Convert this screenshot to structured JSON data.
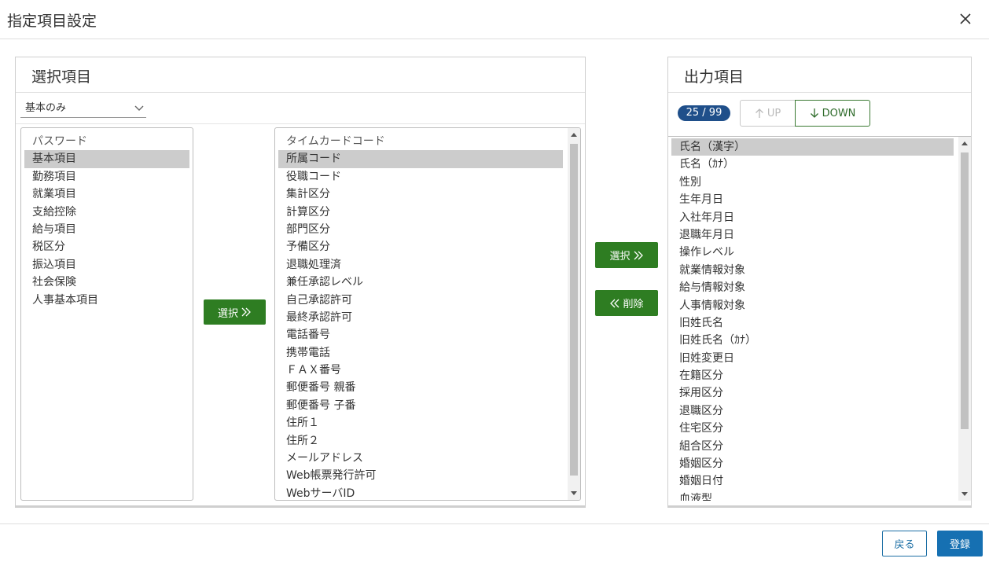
{
  "dialog": {
    "title": "指定項目設定"
  },
  "left_panel": {
    "title": "選択項目",
    "dropdown_value": "基本のみ",
    "categories": [
      "パスワード",
      "基本項目",
      "勤務項目",
      "就業項目",
      "支給控除",
      "給与項目",
      "税区分",
      "振込項目",
      "社会保険",
      "人事基本項目"
    ],
    "selected_category_index": 1,
    "items": [
      "タイムカードコード",
      "所属コード",
      "役職コード",
      "集計区分",
      "計算区分",
      "部門区分",
      "予備区分",
      "退職処理済",
      "兼任承認レベル",
      "自己承認許可",
      "最終承認許可",
      "電話番号",
      "携帯電話",
      "ＦＡＸ番号",
      "郵便番号 親番",
      "郵便番号 子番",
      "住所１",
      "住所２",
      "メールアドレス",
      "Web帳票発行許可",
      "WebサーバID"
    ],
    "selected_item_index": 1,
    "select_label": "選択"
  },
  "middle": {
    "select_label": "選択",
    "remove_label": "削除"
  },
  "right_panel": {
    "title": "出力項目",
    "count": "25 / 99",
    "up_label": "UP",
    "down_label": "DOWN",
    "items": [
      "氏名（漢字）",
      "氏名（ｶﾅ）",
      "性別",
      "生年月日",
      "入社年月日",
      "退職年月日",
      "操作レベル",
      "就業情報対象",
      "給与情報対象",
      "人事情報対象",
      "旧姓氏名",
      "旧姓氏名（ｶﾅ）",
      "旧姓変更日",
      "在籍区分",
      "採用区分",
      "退職区分",
      "住宅区分",
      "組合区分",
      "婚姻区分",
      "婚姻日付",
      "血液型"
    ],
    "selected_index": 0
  },
  "footer": {
    "back_label": "戻る",
    "register_label": "登録"
  },
  "colors": {
    "green": "#2e7d22",
    "badge": "#1f4f8a",
    "primary": "#1670b2",
    "selected_row": "#cccccc"
  }
}
